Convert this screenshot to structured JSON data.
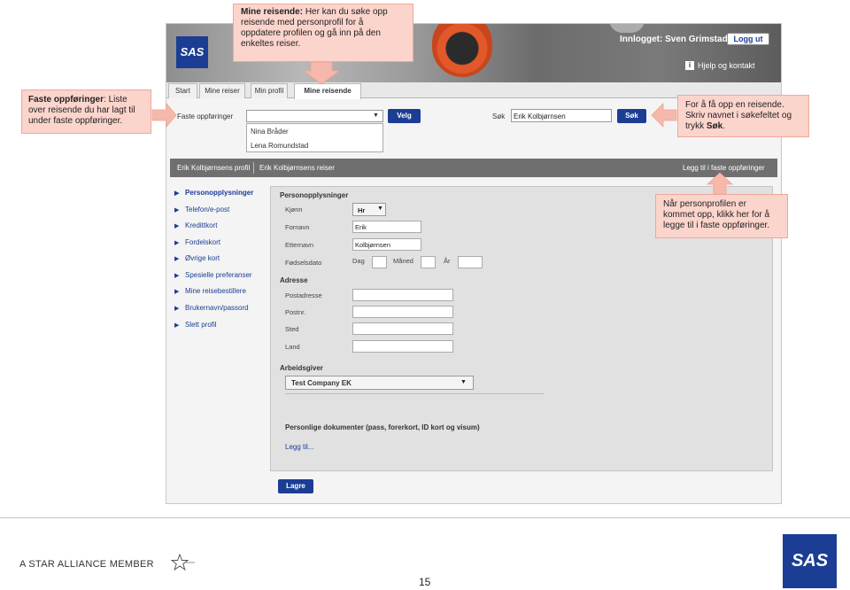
{
  "top_bar": {
    "logo": "SAS",
    "logged_in": "Innlogget: Sven Grimstad",
    "logout_label": "Logg ut",
    "help_icon": "i",
    "help_link": "Hjelp og kontakt"
  },
  "tabs": [
    "Start",
    "Mine reiser",
    "Min profil",
    "Mine reisende"
  ],
  "search_bar": {
    "favorites_label": "Faste oppføringer",
    "favorites_select_value": "",
    "velg_label": "Velg",
    "dropdown_items": [
      "Nina Bråder",
      "Lena Romundstad"
    ],
    "search_label": "Søk",
    "search_value": "Erik Kolbjørnsen",
    "search_button": "Søk"
  },
  "profile_bar": {
    "profile_link": "Erik Kolbjørnsens profil",
    "trips_link": "Erik Kolbjørnsens reiser",
    "add_favorite_link": "Legg til i faste oppføringer"
  },
  "sidebar": [
    "Personopplysninger",
    "Telefon/e-post",
    "Kredittkort",
    "Fordelskort",
    "Øvrige kort",
    "Spesielle preferanser",
    "Mine reisebestillere",
    "Brukernavn/passord",
    "Slett profil"
  ],
  "personal": {
    "title": "Personopplysninger",
    "gender_label": "Kjønn",
    "gender_value": "Hr",
    "firstname_label": "Fornavn",
    "firstname_value": "Erik",
    "lastname_label": "Etternavn",
    "lastname_value": "Kolbjørnsen",
    "birthdate_label": "Fødselsdato",
    "day_label": "Dag",
    "month_label": "Måned",
    "year_label": "År"
  },
  "address": {
    "title": "Adresse",
    "street_label": "Postadresse",
    "zip_label": "Postnr.",
    "city_label": "Sted",
    "country_label": "Land"
  },
  "employer": {
    "title": "Arbeidsgiver",
    "value": "Test Company EK"
  },
  "documents": {
    "title": "Personlige dokumenter (pass, forerkort, ID kort og visum)",
    "add_link": "Legg til..."
  },
  "save_label": "Lagre",
  "callouts": {
    "top_bold": "Mine reisende:",
    "top_text": "Her kan du søke opp reisende med personprofil for å oppdatere profilen og gå inn på den enkeltes reiser.",
    "left_bold": "Faste oppføringer",
    "left_text": ": Liste over reisende du  har lagt til under faste oppføringer.",
    "right_text": "For å få opp en reisende. Skriv navnet i søkefeltet og trykk ",
    "right_bold": "Søk",
    "right_end": ".",
    "bottom_text": "Når personprofilen er kommet opp, klikk her for å legge til i faste oppføringer."
  },
  "footer": {
    "star_alliance": "A STAR ALLIANCE MEMBER",
    "page_number": "15",
    "logo": "SAS"
  },
  "colors": {
    "sas_blue": "#1b3e94",
    "callout_bg": "#fbd4cc",
    "callout_arrow": "#f6b8aa",
    "profile_bar": "#6f6f6f"
  }
}
